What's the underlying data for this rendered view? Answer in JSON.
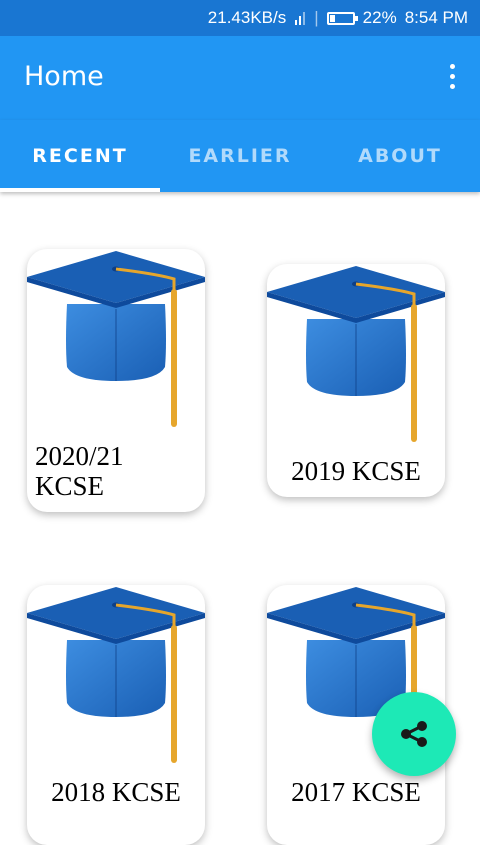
{
  "status_bar": {
    "speed": "21.43KB/s",
    "battery": "22%",
    "time": "8:54 PM",
    "battery_level": 0.22
  },
  "app_bar": {
    "title": "Home",
    "menu_icon": "more-vert-icon"
  },
  "tabs": [
    {
      "label": "RECENT",
      "active": true
    },
    {
      "label": "EARLIER",
      "active": false
    },
    {
      "label": "ABOUT",
      "active": false
    }
  ],
  "cards": [
    {
      "title": "2020/21\nKCSE",
      "icon": "graduation-cap-icon"
    },
    {
      "title": "2019 KCSE",
      "icon": "graduation-cap-icon"
    },
    {
      "title": "2018 KCSE",
      "icon": "graduation-cap-icon"
    },
    {
      "title": "2017 KCSE",
      "icon": "graduation-cap-icon"
    }
  ],
  "fab": {
    "icon": "share-icon"
  },
  "colors": {
    "status_bar": "#1976d2",
    "primary": "#2196f3",
    "accent": "#1de9b6",
    "cap_blue": "#1a5fb4",
    "tassel": "#e6a62c"
  }
}
